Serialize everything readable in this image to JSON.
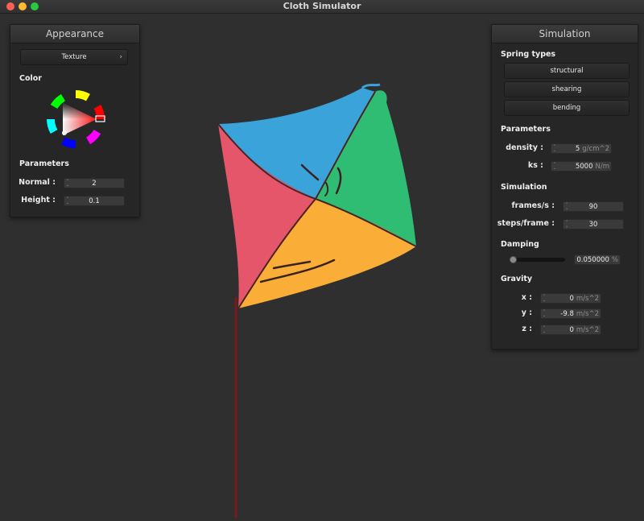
{
  "window": {
    "title": "Cloth Simulator"
  },
  "appearance": {
    "title": "Appearance",
    "texture_label": "Texture",
    "color_label": "Color",
    "parameters_label": "Parameters",
    "normal": {
      "label": "Normal :",
      "value": "2"
    },
    "height": {
      "label": "Height :",
      "value": "0.1"
    }
  },
  "simulation": {
    "title": "Simulation",
    "spring_types_label": "Spring types",
    "springs": [
      "structural",
      "shearing",
      "bending"
    ],
    "parameters_label": "Parameters",
    "density": {
      "label": "density :",
      "value": "5",
      "unit": "g/cm^2"
    },
    "ks": {
      "label": "ks :",
      "value": "5000",
      "unit": "N/m"
    },
    "simulation_label": "Simulation",
    "frames": {
      "label": "frames/s :",
      "value": "90"
    },
    "steps": {
      "label": "steps/frame :",
      "value": "30"
    },
    "damping_label": "Damping",
    "damping": {
      "value": "0.050000",
      "unit": "%",
      "fraction": 0.05
    },
    "gravity_label": "Gravity",
    "gx": {
      "label": "x :",
      "value": "0",
      "unit": "m/s^2"
    },
    "gy": {
      "label": "y :",
      "value": "-9.8",
      "unit": "m/s^2"
    },
    "gz": {
      "label": "z :",
      "value": "0",
      "unit": "m/s^2"
    }
  },
  "colors": {
    "quad_blue": "#3aa3da",
    "quad_green": "#2ebd73",
    "quad_red": "#e5566b",
    "quad_orange": "#fbae37",
    "pole": "#7a1a1a"
  }
}
